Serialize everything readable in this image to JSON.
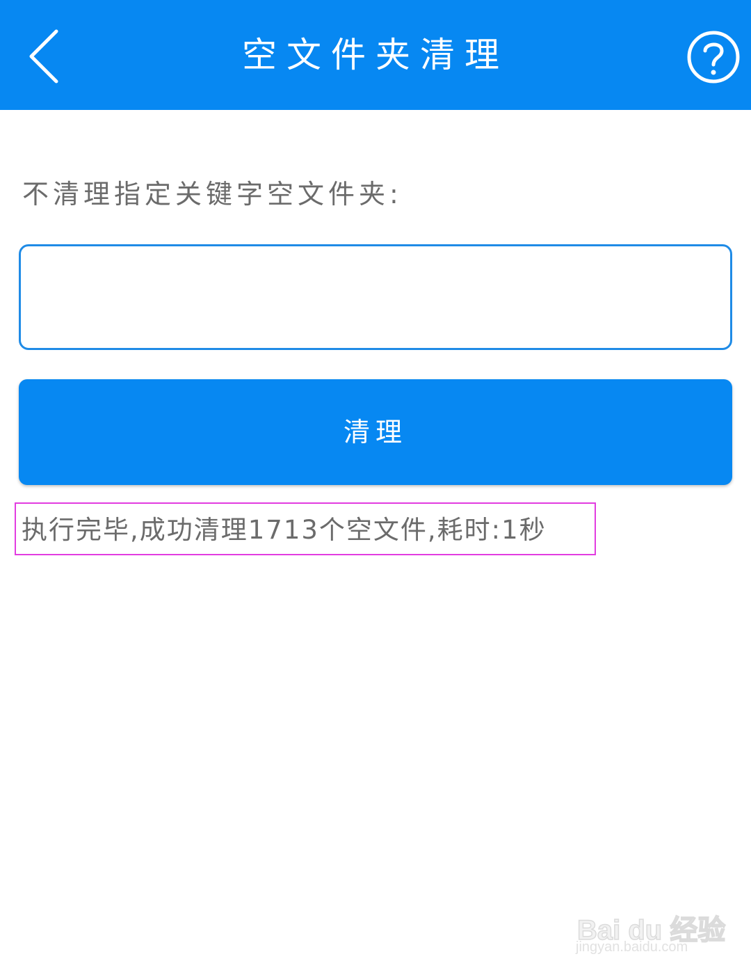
{
  "header": {
    "title": "空文件夹清理",
    "back_icon": "chevron-left-icon",
    "help_icon": "question-circle-icon",
    "background_color": "#0788f2"
  },
  "form": {
    "label": "不清理指定关键字空文件夹:",
    "keyword_input_value": "",
    "clean_button_label": "清理",
    "input_border_color": "#1f8be6",
    "button_color": "#0788f2"
  },
  "result": {
    "message": "执行完毕,成功清理1713个空文件,耗时:1秒",
    "highlight_color": "#e23ce0"
  },
  "watermark": {
    "logo_text": "Bai du 经验",
    "url": "jingyan.baidu.com"
  }
}
